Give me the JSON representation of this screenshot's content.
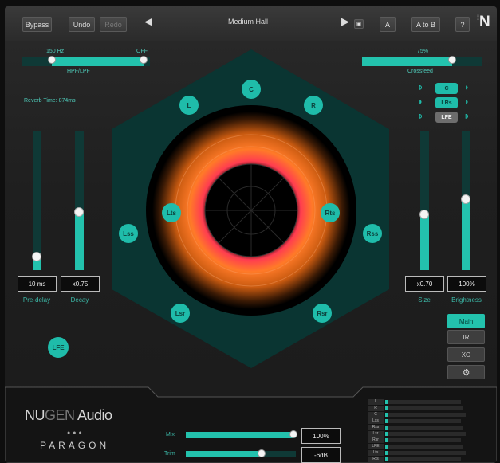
{
  "toolbar": {
    "bypass": "Bypass",
    "undo": "Undo",
    "redo": "Redo",
    "preset": "Medium Hall",
    "prev_icon": "triangle-left-icon",
    "next_icon": "triangle-right-icon",
    "save_icon": "save-icon",
    "a": "A",
    "a_to_b": "A to B",
    "help": "?",
    "logo": "N"
  },
  "hpf_lpf": {
    "label": "HPF/LPF",
    "low_label": "150 Hz",
    "high_label": "OFF",
    "low_fraction": 0.23,
    "high_fraction": 0.95
  },
  "crossfeed": {
    "label": "Crossfeed",
    "value_label": "75%",
    "value": 0.75
  },
  "reverb_time": "Reverb Time: 874ms",
  "pre_delay": {
    "value": "10 ms",
    "label": "Pre-delay",
    "level": 0.1
  },
  "decay": {
    "value": "x0.75",
    "label": "Decay",
    "level": 0.42
  },
  "size": {
    "value": "x0.70",
    "label": "Size",
    "level": 0.4
  },
  "brightness": {
    "value": "100%",
    "label": "Brightness",
    "level": 0.51
  },
  "speakers": [
    "C",
    "L",
    "R",
    "Lts",
    "Rts",
    "Lss",
    "Rss",
    "Lsr",
    "Rsr"
  ],
  "lfe": "LFE",
  "crossover": [
    {
      "label": "C",
      "state": "on"
    },
    {
      "label": "LRs",
      "state": "on"
    },
    {
      "label": "LFE",
      "state": "off"
    }
  ],
  "side_buttons": {
    "main": "Main",
    "ir": "IR",
    "xo": "XO",
    "settings_icon": "gear-icon"
  },
  "brand": {
    "nu": "NU",
    "gen": "GEN",
    "audio": " Audio",
    "product": "PARAGON",
    "dots": "●●●"
  },
  "mix": {
    "label": "Mix",
    "value": "100%",
    "level": 0.98
  },
  "trim": {
    "label": "Trim",
    "value": "-6dB",
    "level": 0.69
  },
  "meters": [
    {
      "label": "L",
      "level": 0.04
    },
    {
      "label": "R",
      "level": 0.04
    },
    {
      "label": "C",
      "level": 0.04
    },
    {
      "label": "Lss",
      "level": 0.04
    },
    {
      "label": "Rss",
      "level": 0.04
    },
    {
      "label": "Lsr",
      "level": 0.04
    },
    {
      "label": "Rsr",
      "level": 0.04
    },
    {
      "label": "LFE",
      "level": 0.04
    },
    {
      "label": "Lts",
      "level": 0.04
    },
    {
      "label": "Rts",
      "level": 0.04
    }
  ]
}
